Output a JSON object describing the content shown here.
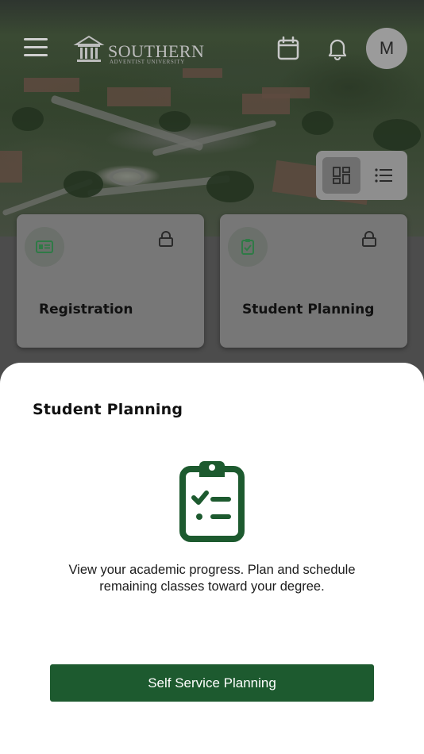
{
  "header": {
    "logo_text": "SOUTHERN",
    "logo_subtext": "ADVENTIST UNIVERSITY",
    "avatar_initial": "M"
  },
  "cards": [
    {
      "label": "Registration",
      "icon": "id-card-icon",
      "locked": true
    },
    {
      "label": "Student Planning",
      "icon": "clipboard-check-icon",
      "locked": true
    }
  ],
  "sheet": {
    "title": "Student Planning",
    "icon": "clipboard-checklist-icon",
    "description": "View your academic progress. Plan and schedule remaining classes toward your degree.",
    "button_label": "Self Service Planning"
  },
  "colors": {
    "brand_green": "#1d5a2f",
    "card_icon_green": "#2f7a46"
  }
}
